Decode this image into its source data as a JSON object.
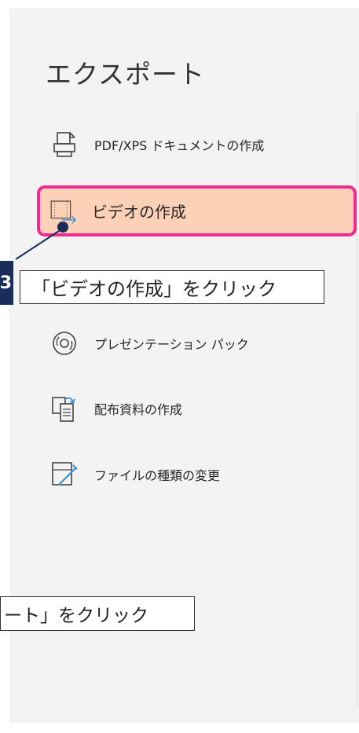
{
  "panel": {
    "heading": "エクスポート",
    "items": [
      {
        "label": "PDF/XPS ドキュメントの作成",
        "icon": "pdf-document-icon"
      },
      {
        "label": "ビデオの作成",
        "icon": "video-create-icon",
        "selected": true
      },
      {
        "label": "プレゼンテーション パック",
        "icon": "cd-package-icon"
      },
      {
        "label": "配布資料の作成",
        "icon": "handout-icon"
      },
      {
        "label": "ファイルの種類の変更",
        "icon": "change-file-type-icon"
      }
    ]
  },
  "annotations": {
    "step_number": "3",
    "instruction": "「ビデオの作成」をクリック",
    "previous_instruction": "ート」をクリック"
  },
  "colors": {
    "selected_fill": "#fcd1b8",
    "selected_border": "#f02c92",
    "badge": "#1a2c5a"
  }
}
